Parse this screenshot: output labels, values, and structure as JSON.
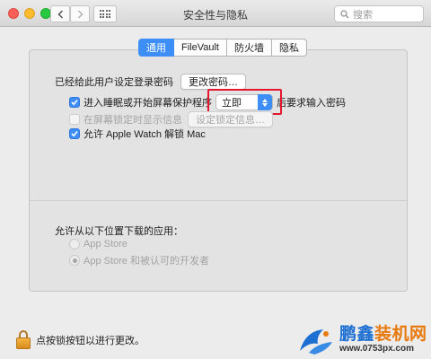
{
  "window": {
    "title": "安全性与隐私",
    "search_placeholder": "搜索"
  },
  "tabs": [
    {
      "label": "通用",
      "active": true
    },
    {
      "label": "FileVault",
      "active": false
    },
    {
      "label": "防火墙",
      "active": false
    },
    {
      "label": "隐私",
      "active": false
    }
  ],
  "general": {
    "password_label": "已经给此用户设定登录密码",
    "change_password_button": "更改密码…",
    "require_password_prefix": "进入睡眠或开始屏幕保护程序",
    "require_password_value": "立即",
    "require_password_suffix": "后要求输入密码",
    "show_message_label": "在屏幕锁定时显示信息",
    "set_lock_message_button": "设定锁定信息…",
    "watch_unlock_label": "允许 Apple Watch 解锁 Mac"
  },
  "downloads": {
    "heading": "允许从以下位置下载的应用：",
    "options": [
      {
        "label": "App Store",
        "selected": false
      },
      {
        "label": "App Store 和被认可的开发者",
        "selected": true
      }
    ]
  },
  "footer": {
    "lock_text": "点按锁按钮以进行更改。"
  },
  "watermark": {
    "brand_blue": "鹏鑫",
    "brand_orange": "装机网",
    "url": "www.0753px.com"
  },
  "colors": {
    "accent": "#3e8ef7",
    "highlight": "#e5172f"
  }
}
